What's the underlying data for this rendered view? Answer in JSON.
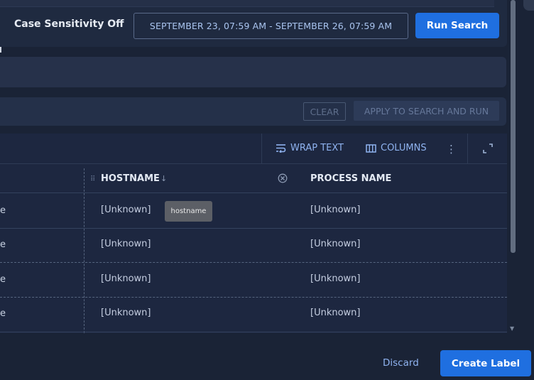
{
  "search": {
    "case_sensitivity": "Case Sensitivity Off",
    "date_range": "SEPTEMBER 23, 07:59 AM - SEPTEMBER 26, 07:59 AM",
    "run_label": "Run Search"
  },
  "filters": {
    "clear_label": "CLEAR",
    "apply_label": "APPLY TO SEARCH AND RUN"
  },
  "table_toolbar": {
    "wrap_text": "WRAP TEXT",
    "columns": "COLUMNS",
    "kebab_glyph": "⋮"
  },
  "table": {
    "columns": [
      "HOSTNAME",
      "PROCESS NAME"
    ],
    "sort_indicator": "↓",
    "rows": [
      {
        "left": "e",
        "hostname": "[Unknown]",
        "process_name": "[Unknown]"
      },
      {
        "left": "e",
        "hostname": "[Unknown]",
        "process_name": "[Unknown]"
      },
      {
        "left": "e",
        "hostname": "[Unknown]",
        "process_name": "[Unknown]"
      },
      {
        "left": "e",
        "hostname": "[Unknown]",
        "process_name": "[Unknown]"
      }
    ],
    "tooltip": "hostname"
  },
  "footer": {
    "discard_label": "Discard",
    "create_label": "Create Label"
  },
  "colors": {
    "accent": "#1f6fe0",
    "background": "#1a2336",
    "link": "#8fb3f0"
  },
  "icons": [
    "wrap-text-icon",
    "columns-icon",
    "kebab-icon",
    "expand-icon",
    "drag-handle-icon",
    "sort-down-icon",
    "clear-circle-icon",
    "scroll-down-icon"
  ]
}
